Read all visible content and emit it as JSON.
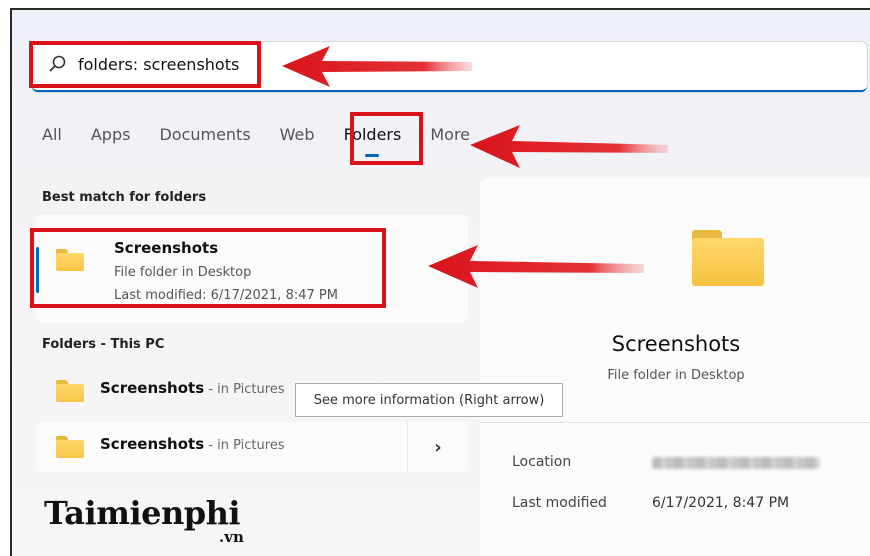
{
  "search": {
    "query": "folders: screenshots"
  },
  "tabs": [
    {
      "label": "All"
    },
    {
      "label": "Apps"
    },
    {
      "label": "Documents"
    },
    {
      "label": "Web"
    },
    {
      "label": "Folders",
      "active": true
    },
    {
      "label": "More"
    }
  ],
  "best_match": {
    "heading": "Best match for folders",
    "name": "Screenshots",
    "type": "File folder in Desktop",
    "modified": "Last modified: 6/17/2021, 8:47 PM"
  },
  "folders_pc": {
    "heading": "Folders - This PC",
    "items": [
      {
        "name": "Screenshots",
        "location": " - in Pictures"
      },
      {
        "name": "Screenshots",
        "location": " - in Pictures"
      }
    ]
  },
  "tooltip": "See more information (Right arrow)",
  "detail": {
    "name": "Screenshots",
    "type": "File folder in Desktop",
    "location_label": "Location",
    "modified_label": "Last modified",
    "modified_value": "6/17/2021, 8:47 PM"
  },
  "watermark": {
    "brand": "Taimienphi",
    "tld": ".vn"
  },
  "colors": {
    "accent": "#0067c0",
    "annotation_red": "#d8141a",
    "folder": "#f7c645"
  }
}
